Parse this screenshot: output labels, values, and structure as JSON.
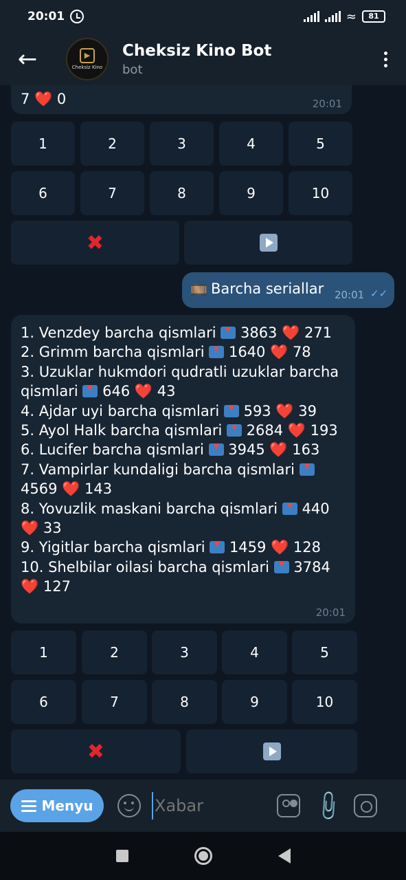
{
  "status": {
    "time": "20:01",
    "battery": "81"
  },
  "header": {
    "title": "Cheksiz Kino Bot",
    "subtitle": "bot",
    "avatar_label": "Cheksiz Kino"
  },
  "prev_message": {
    "text_fragment": "7 ❤️ 0",
    "time": "20:01"
  },
  "keyboard_top": {
    "row1": [
      "1",
      "2",
      "3",
      "4",
      "5"
    ],
    "row2": [
      "6",
      "7",
      "8",
      "9",
      "10"
    ],
    "close": "✖",
    "next": "▶️"
  },
  "outgoing": {
    "icon": "🎞️",
    "text": "Barcha seriallar",
    "time": "20:01"
  },
  "list_message": {
    "items": [
      {
        "n": "1.",
        "title": "Venzdey barcha qismlari",
        "downloads": "3863",
        "likes": "271"
      },
      {
        "n": "2.",
        "title": "Grimm barcha qismlari",
        "downloads": "1640",
        "likes": "78"
      },
      {
        "n": "3.",
        "title": "Uzuklar hukmdori qudratli uzuklar barcha qismlari",
        "downloads": "646",
        "likes": "43"
      },
      {
        "n": "4.",
        "title": "Ajdar uyi barcha qismlari",
        "downloads": "593",
        "likes": "39"
      },
      {
        "n": "5.",
        "title": "Ayol Halk barcha qismlari",
        "downloads": "2684",
        "likes": "193"
      },
      {
        "n": "6.",
        "title": "Lucifer barcha qismlari",
        "downloads": "3945",
        "likes": "163"
      },
      {
        "n": "7.",
        "title": "Vampirlar kundaligi barcha qismlari",
        "downloads": "4569",
        "likes": "143"
      },
      {
        "n": "8.",
        "title": "Yovuzlik maskani barcha qismlari",
        "downloads": "440",
        "likes": "33"
      },
      {
        "n": "9.",
        "title": "Yigitlar barcha qismlari",
        "downloads": "1459",
        "likes": "128"
      },
      {
        "n": "10.",
        "title": "Shelbilar oilasi barcha qismlari",
        "downloads": "3784",
        "likes": "127"
      }
    ],
    "time": "20:01"
  },
  "keyboard_bottom": {
    "row1": [
      "1",
      "2",
      "3",
      "4",
      "5"
    ],
    "row2": [
      "6",
      "7",
      "8",
      "9",
      "10"
    ],
    "close": "✖",
    "next": "▶️"
  },
  "input": {
    "menu_label": "Menyu",
    "placeholder": "Xabar"
  }
}
